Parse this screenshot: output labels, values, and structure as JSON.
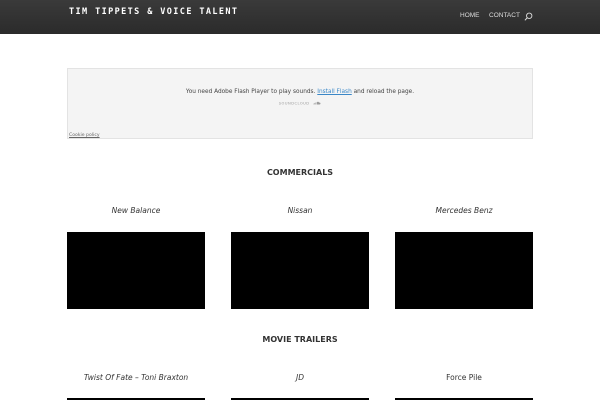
{
  "header": {
    "logo": "Tim Tippets & Voice Talent",
    "nav": {
      "home": "HOME",
      "contact": "CONTACT"
    },
    "search_icon": "search-icon"
  },
  "soundcloud": {
    "message_before": "You need Adobe Flash Player to play sounds.",
    "install_link": "Install Flash",
    "message_after": "and reload the page.",
    "brand": "SOUNDCLOUD",
    "brand_icon": "soundcloud-cloud-icon",
    "cookie_policy": "Cookie policy"
  },
  "sections": [
    {
      "title": "COMMERCIALS",
      "items": [
        {
          "label": "New Balance"
        },
        {
          "label": "Nissan"
        },
        {
          "label": "Mercedes Benz"
        }
      ]
    },
    {
      "title": "MOVIE TRAILERS",
      "items": [
        {
          "label": "Twist Of Fate – Toni Braxton"
        },
        {
          "label": "JD"
        },
        {
          "label": "Force Pile"
        }
      ]
    }
  ],
  "colors": {
    "header_bg": "#2b2b2b",
    "link": "#3a87c7",
    "video_bg": "#000000"
  }
}
